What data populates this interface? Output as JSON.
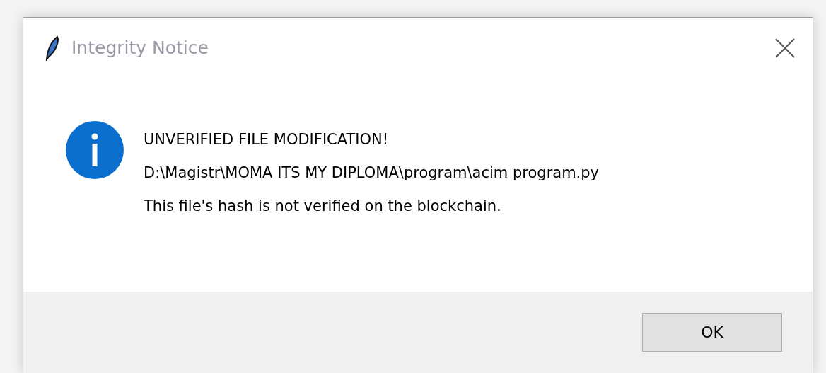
{
  "window": {
    "title": "Integrity Notice"
  },
  "message": {
    "kind": "info",
    "heading": "UNVERIFIED FILE MODIFICATION!",
    "path": "D:\\Magistr\\MOMA ITS MY DIPLOMA\\program\\acim program.py",
    "detail": "This file's hash is not verified on the blockchain."
  },
  "buttons": [
    {
      "label": "OK"
    }
  ]
}
